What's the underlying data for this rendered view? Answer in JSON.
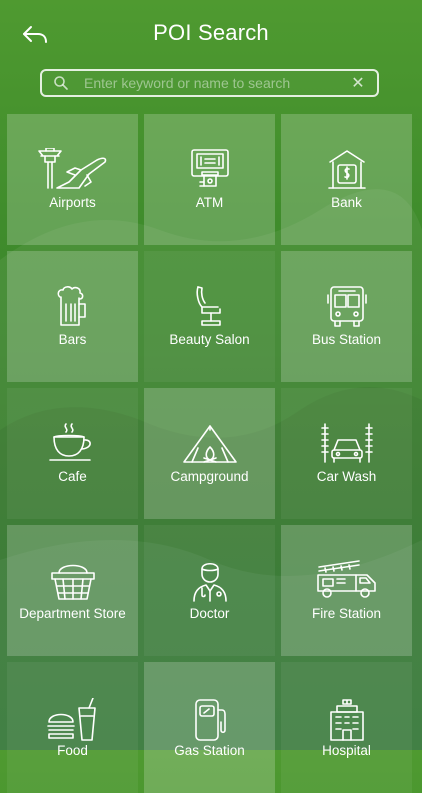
{
  "header": {
    "title": "POI Search",
    "back_icon": "back-arrow-icon"
  },
  "search": {
    "placeholder": "Enter keyword or name to search",
    "value": "",
    "search_icon": "search-icon",
    "clear_icon": "clear-icon",
    "clear_glyph": "✕"
  },
  "categories": [
    {
      "label": "Airports",
      "icon": "airport-icon"
    },
    {
      "label": "ATM",
      "icon": "atm-icon"
    },
    {
      "label": "Bank",
      "icon": "bank-icon"
    },
    {
      "label": "Bars",
      "icon": "beer-mug-icon"
    },
    {
      "label": "Beauty Salon",
      "icon": "salon-chair-icon"
    },
    {
      "label": "Bus Station",
      "icon": "bus-icon"
    },
    {
      "label": "Cafe",
      "icon": "coffee-cup-icon"
    },
    {
      "label": "Campground",
      "icon": "tent-icon"
    },
    {
      "label": "Car Wash",
      "icon": "car-wash-icon"
    },
    {
      "label": "Department Store",
      "icon": "basket-icon"
    },
    {
      "label": "Doctor",
      "icon": "doctor-icon"
    },
    {
      "label": "Fire Station",
      "icon": "fire-truck-icon"
    },
    {
      "label": "Food",
      "icon": "burger-drink-icon"
    },
    {
      "label": "Gas Station",
      "icon": "fuel-pump-icon"
    },
    {
      "label": "Hospital",
      "icon": "hospital-building-icon"
    }
  ],
  "colors": {
    "background": "#3f8c2c",
    "text": "#ffffff",
    "tile_light": "rgba(255,255,255,0.20)",
    "tile_dark": "rgba(255,255,255,0.06)"
  }
}
